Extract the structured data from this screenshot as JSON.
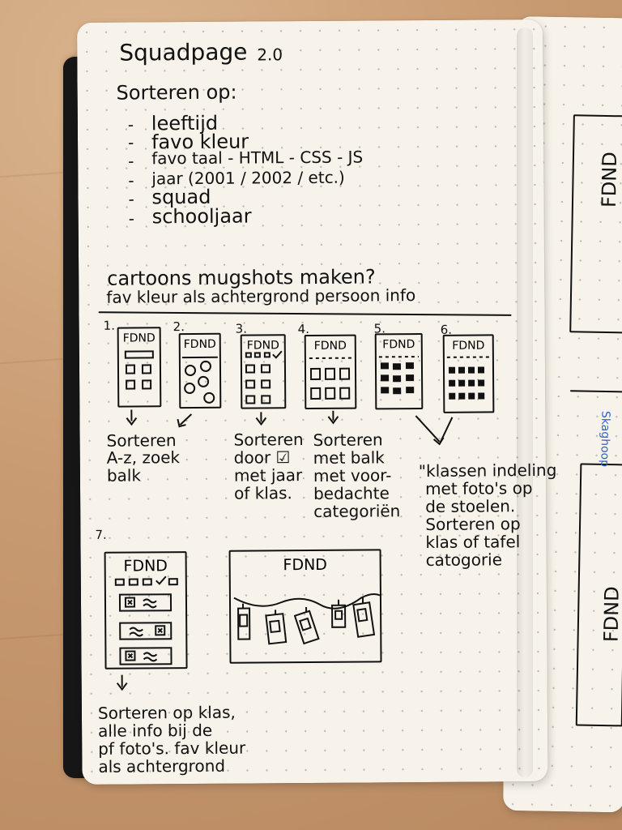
{
  "title": "Squadpage",
  "version": "2.0",
  "sort_heading": "Sorteren op:",
  "sort_items": [
    "leeftijd",
    "favo kleur",
    "favo taal - HTML - CSS - JS",
    "jaar (2001 / 2002 / etc.)",
    "squad",
    "schooljaar"
  ],
  "cartoon_line_1": "cartoons mugshots maken?",
  "cartoon_line_2": "fav kleur als achtergrond persoon info",
  "sketch_numbers": [
    "1.",
    "2.",
    "3.",
    "4.",
    "5.",
    "6.",
    "7."
  ],
  "sketch_labels": [
    "FDND",
    "FDND",
    "FDND",
    "FDND",
    "FDND",
    "FDND",
    "FDND",
    "FDND"
  ],
  "notes": [
    [
      "Sorteren",
      "A-z, zoek",
      "balk"
    ],
    [
      "Sorteren",
      "door ☑",
      "met jaar",
      "of klas."
    ],
    [
      "Sorteren",
      "met balk",
      "met voor-",
      "bedachte",
      "categoriën"
    ],
    [
      "\"klassen indeling",
      "met foto's op",
      "de stoelen.",
      "Sorteren op",
      "klas of tafel",
      "catogorie"
    ],
    [
      "Sorteren op klas,",
      "alle info bij de",
      "pf foto's. fav kleur",
      "als achtergrond"
    ]
  ],
  "right_page": {
    "sketch_text_top": "FDND",
    "sketch_text_bottom": "FDND",
    "blue_text": "Skaghoop"
  },
  "colors": {
    "ink": "#111111",
    "page": "#f7f3ea",
    "desk": "#c99b72",
    "blue_ink": "#2c63c7"
  }
}
